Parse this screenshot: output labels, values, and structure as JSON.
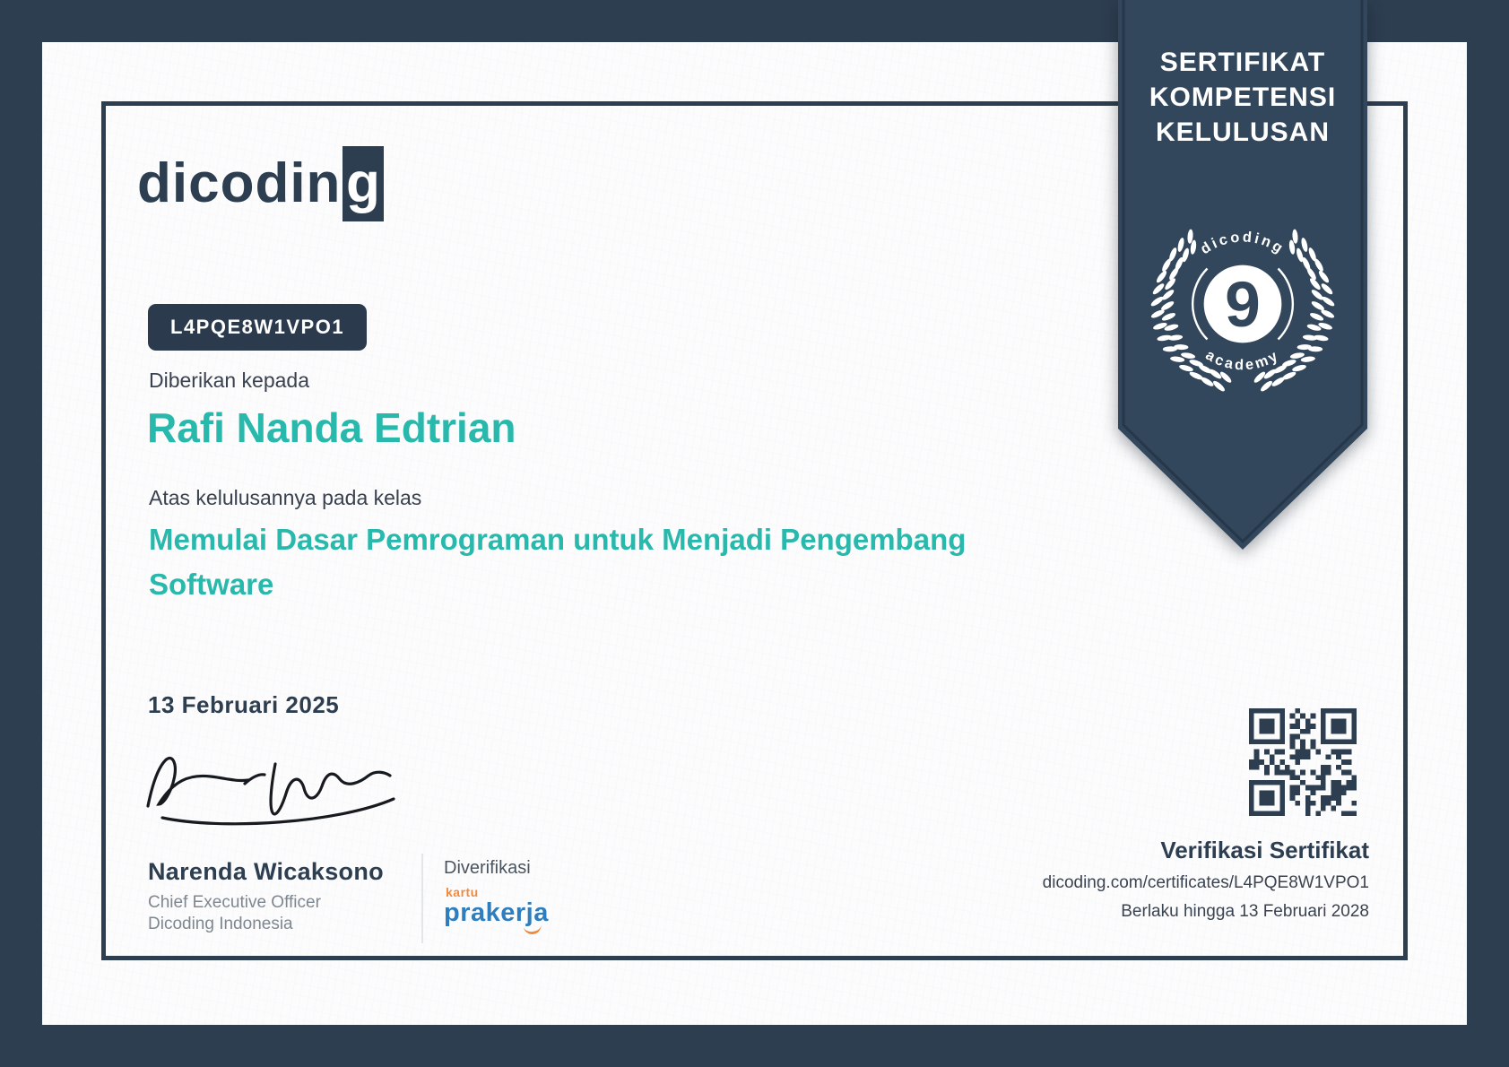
{
  "brand": {
    "logo_prefix": "dicodin",
    "logo_suffix": "g",
    "logo_full": "dicoding"
  },
  "ribbon": {
    "lines": [
      "SERTIFIKAT",
      "KOMPETENSI",
      "KELULUSAN"
    ]
  },
  "emblem": {
    "arc_top": "dicoding",
    "number": "9",
    "arc_bottom": "academy",
    "wreath_icon": "laurel-wreath"
  },
  "certificate": {
    "id": "L4PQE8W1VPO1",
    "given_to_label": "Diberikan kepada",
    "recipient_name": "Rafi Nanda Edtrian",
    "course_label": "Atas kelulusannya pada kelas",
    "course_title": "Memulai Dasar Pemrograman untuk Menjadi Pengembang Software",
    "course_title_lines": [
      "Memulai Dasar Pemrograman untuk Menjadi Pengembang",
      "Software"
    ],
    "issue_date": "13 Februari 2025"
  },
  "signer": {
    "name": "Narenda Wicaksono",
    "title": "Chief Executive Officer",
    "organization": "Dicoding Indonesia",
    "signature_icon": "handwritten-signature"
  },
  "partner": {
    "verified_label": "Diverifikasi",
    "logo_top": "kartu",
    "logo_name": "prakerja"
  },
  "verification": {
    "qr_icon": "qr-code",
    "title": "Verifikasi Sertifikat",
    "url": "dicoding.com/certificates/L4PQE8W1VPO1",
    "validity": "Berlaku hingga 13 Februari 2028"
  },
  "colors": {
    "navy": "#2d3e50",
    "ribbon_navy": "#33475c",
    "teal": "#29b8ac",
    "text_dark": "#39414e",
    "text_gray": "#7e8790",
    "prakerja_blue": "#2e7dbe",
    "prakerja_orange": "#f08a3e",
    "paper": "#fcfcfd"
  }
}
